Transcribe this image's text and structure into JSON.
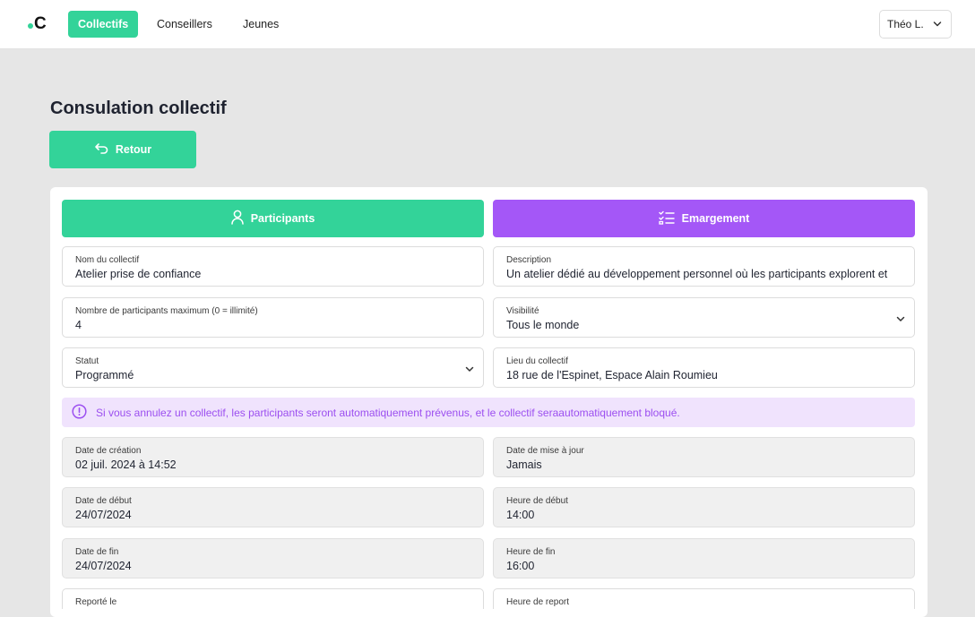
{
  "header": {
    "logo_text": "C",
    "nav": [
      {
        "label": "Collectifs",
        "active": true
      },
      {
        "label": "Conseillers",
        "active": false
      },
      {
        "label": "Jeunes",
        "active": false
      }
    ],
    "user_label": "Théo L."
  },
  "page": {
    "title": "Consulation collectif",
    "back_label": "Retour"
  },
  "tabs": {
    "participants_label": "Participants",
    "emargement_label": "Emargement"
  },
  "fields": {
    "nom": {
      "label": "Nom du collectif",
      "value": "Atelier prise de confiance"
    },
    "description": {
      "label": "Description",
      "value": "Un atelier dédié au développement personnel où les participants explorent et"
    },
    "max_participants": {
      "label": "Nombre de participants maximum (0 = illimité)",
      "value": "4"
    },
    "visibilite": {
      "label": "Visibilité",
      "value": "Tous le monde"
    },
    "statut": {
      "label": "Statut",
      "value": "Programmé"
    },
    "lieu": {
      "label": "Lieu du collectif",
      "value": "18 rue de l'Espinet, Espace Alain Roumieu"
    },
    "date_creation": {
      "label": "Date de création",
      "value": "02 juil. 2024 à 14:52"
    },
    "date_maj": {
      "label": "Date de mise à jour",
      "value": "Jamais"
    },
    "date_debut": {
      "label": "Date de début",
      "value": "24/07/2024"
    },
    "heure_debut": {
      "label": "Heure de début",
      "value": "14:00"
    },
    "date_fin": {
      "label": "Date de fin",
      "value": "24/07/2024"
    },
    "heure_fin": {
      "label": "Heure de fin",
      "value": "16:00"
    },
    "reporte_le": {
      "label": "Reporté le",
      "value": ""
    },
    "heure_report": {
      "label": "Heure de report",
      "value": ""
    }
  },
  "alert": {
    "text": "Si vous annulez un collectif, les participants seront automatiquement prévenus, et le collectif seraautomatiquement bloqué."
  },
  "colors": {
    "primary_green": "#33d399",
    "purple": "#a457f7",
    "alert_bg": "#f0e3fd",
    "alert_text": "#9c4ff0"
  }
}
